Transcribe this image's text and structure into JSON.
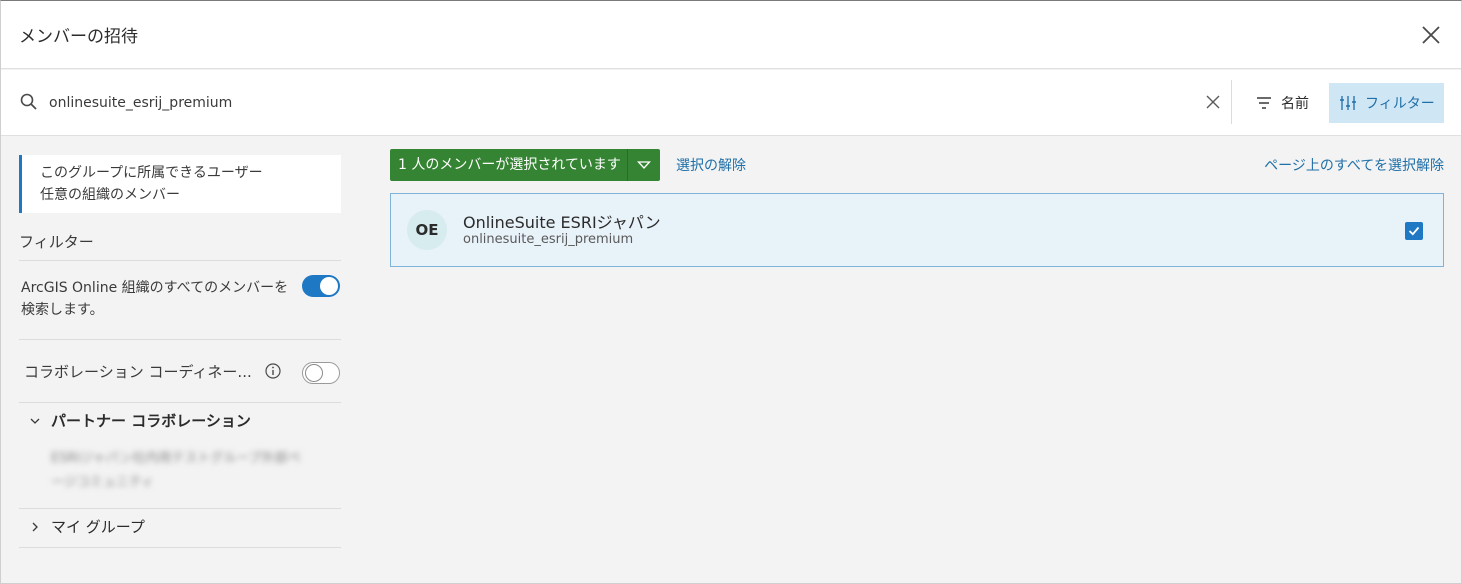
{
  "dialog": {
    "title": "メンバーの招待"
  },
  "search": {
    "value": "onlinesuite_esrij_premium",
    "placeholder": ""
  },
  "toolbar": {
    "sort_label": "名前",
    "filter_label": "フィルター"
  },
  "sidebar": {
    "notice_line1": "このグループに所属できるユーザー",
    "notice_line2": "任意の組織のメンバー",
    "filters_heading": "フィルター",
    "arcgis_toggle_label": "ArcGIS Online 組織のすべてのメンバーを検索します。",
    "arcgis_toggle_on": true,
    "collab_toggle_label": "コラボレーション コーディネー...",
    "collab_toggle_on": false,
    "partner_collab_label": "パートナー コラボレーション",
    "blurred_line1": "ESRIジャパン社内用テストグループ外部ペ",
    "blurred_line2": "ージコミュニティ",
    "my_groups_label": "マイ グループ"
  },
  "selection": {
    "selected_label": "1 人のメンバーが選択されています",
    "clear_selection": "選択の解除",
    "deselect_page": "ページ上のすべてを選択解除"
  },
  "members": [
    {
      "initials": "OE",
      "name": "OnlineSuite ESRIジャパン",
      "username": "onlinesuite_esrij_premium",
      "checked": true
    }
  ],
  "colors": {
    "accent": "#1f78c4",
    "selected_button": "#358433",
    "filter_active_bg": "#cfe6f5"
  }
}
